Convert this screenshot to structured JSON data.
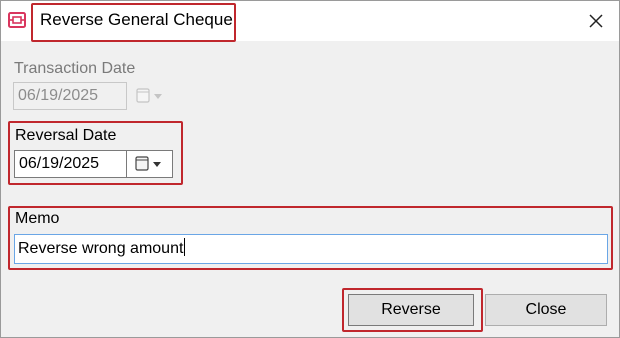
{
  "dialog": {
    "title": "Reverse General Cheque",
    "close_glyph": "✕",
    "app_icon": "cheque-app-icon"
  },
  "transaction_date": {
    "label": "Transaction Date",
    "value": "06/19/2025",
    "enabled": false,
    "calendar_icon": "calendar-dropdown-icon"
  },
  "reversal_date": {
    "label": "Reversal Date",
    "value": "06/19/2025",
    "enabled": true,
    "calendar_icon": "calendar-dropdown-icon"
  },
  "memo": {
    "label": "Memo",
    "value": "Reverse wrong amount"
  },
  "buttons": {
    "reverse_label": "Reverse",
    "close_label": "Close"
  },
  "colors": {
    "highlight": "#c0272d",
    "app_icon": "#d9365e",
    "input_focus_border": "#6aa6e6",
    "dialog_background": "#f0f0f0"
  }
}
